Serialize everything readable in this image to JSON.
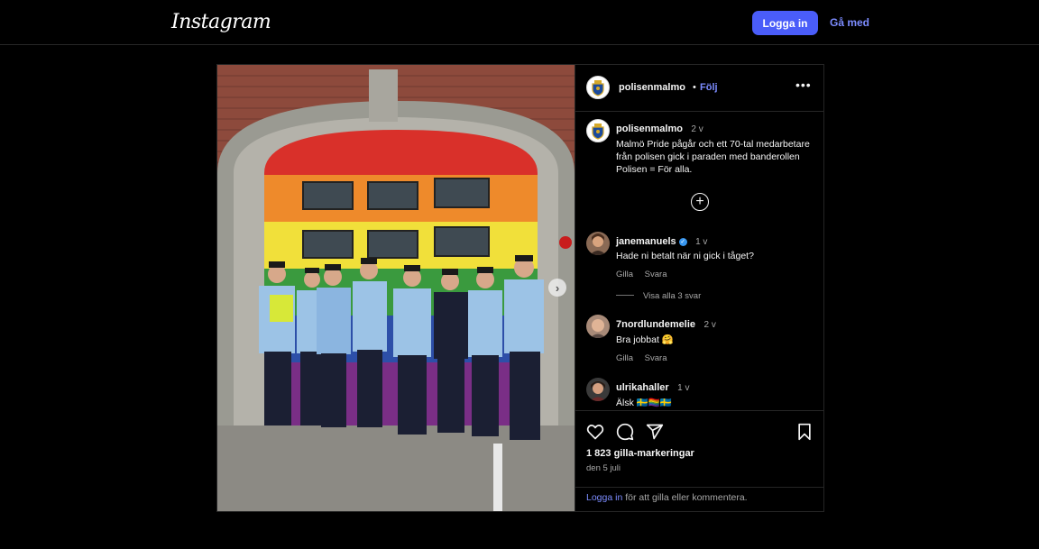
{
  "app": {
    "logo": "Instagram"
  },
  "nav": {
    "login_label": "Logga in",
    "signup_label": "Gå med"
  },
  "post": {
    "header": {
      "username": "polisenmalmo",
      "separator": "•",
      "follow_label": "Följ",
      "more_label": "•••"
    },
    "caption": {
      "username": "polisenmalmo",
      "time": "2 v",
      "text": "Malmö Pride pågår och ett 70-tal medarbetare från polisen gick i paraden med banderollen Polisen = För alla."
    },
    "load_more_label": "+",
    "comments": [
      {
        "username": "janemanuels",
        "verified": true,
        "time": "1 v",
        "text": "Hade ni betalt när ni gick i tåget?",
        "like_label": "Gilla",
        "reply_label": "Svara",
        "view_replies": "Visa alla 3 svar"
      },
      {
        "username": "7nordlundemelie",
        "time": "2 v",
        "text": "Bra jobbat 🤗",
        "like_label": "Gilla",
        "reply_label": "Svara"
      },
      {
        "username": "ulrikahaller",
        "time": "1 v",
        "text": "Älsk 🇸🇪🏳️‍🌈🇸🇪"
      }
    ],
    "likes": "1 823 gilla-markeringar",
    "date": "den 5 juli",
    "login_prompt": {
      "link": "Logga in",
      "rest": " för att gilla eller kommentera."
    },
    "carousel_next": "›"
  },
  "colors": {
    "accent": "#4a5df9",
    "link": "#7c8cff",
    "background": "#000000",
    "border": "#262626"
  },
  "icons": [
    "heart-icon",
    "comment-icon",
    "share-icon",
    "bookmark-icon",
    "more-icon",
    "plus-circle-icon",
    "verified-icon",
    "chevron-right-icon"
  ]
}
